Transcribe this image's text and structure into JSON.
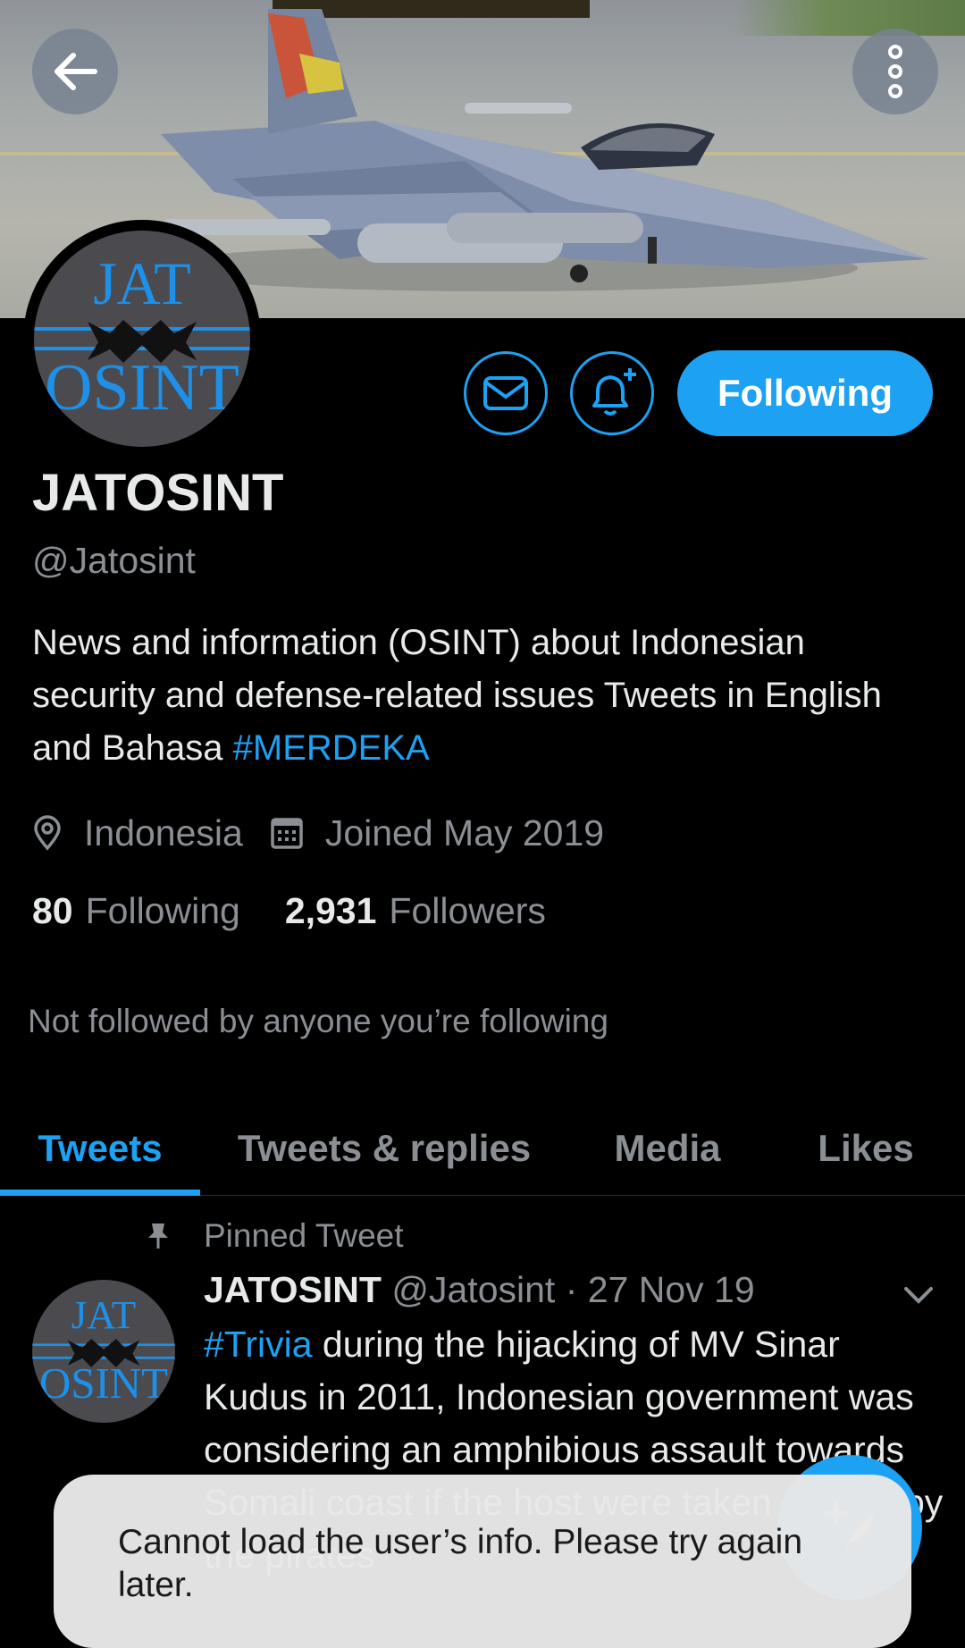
{
  "header": {
    "back_icon": "arrow-left-icon",
    "more_icon": "more-vertical-icon"
  },
  "profile": {
    "avatar_text_top": "JAT",
    "avatar_text_bottom": "OSINT",
    "name": "JATOSINT",
    "handle": "@Jatosint",
    "bio_text": "News and information (OSINT) about Indonesian security and defense-related issues   Tweets in English and Bahasa  ",
    "bio_hashtag": "#MERDEKA",
    "location": "Indonesia",
    "joined": "Joined May 2019",
    "following_count": "80",
    "following_label": "Following",
    "followers_count": "2,931",
    "followers_label": "Followers",
    "not_followed": "Not followed by anyone you’re following"
  },
  "actions": {
    "message_icon": "mail-icon",
    "notify_icon": "bell-plus-icon",
    "follow_label": "Following"
  },
  "tabs": [
    {
      "label": "Tweets",
      "active": true
    },
    {
      "label": "Tweets & replies",
      "active": false
    },
    {
      "label": "Media",
      "active": false
    },
    {
      "label": "Likes",
      "active": false
    }
  ],
  "pinned_tweet": {
    "pinned_label": "Pinned Tweet",
    "author": "JATOSINT",
    "handle": "@Jatosint",
    "date": " · 27 Nov 19",
    "hashtag": "#Trivia",
    "text": " during the hijacking of MV Sinar Kudus in 2011, Indonesian government was considering an amphibious assault towards Somali coast if the host were taken ashore by the pirates"
  },
  "toast": {
    "message": "Cannot load the user’s info. Please try again later."
  },
  "colors": {
    "accent": "#1da1f2",
    "background": "#000000",
    "secondary_text": "#8b8f94"
  }
}
